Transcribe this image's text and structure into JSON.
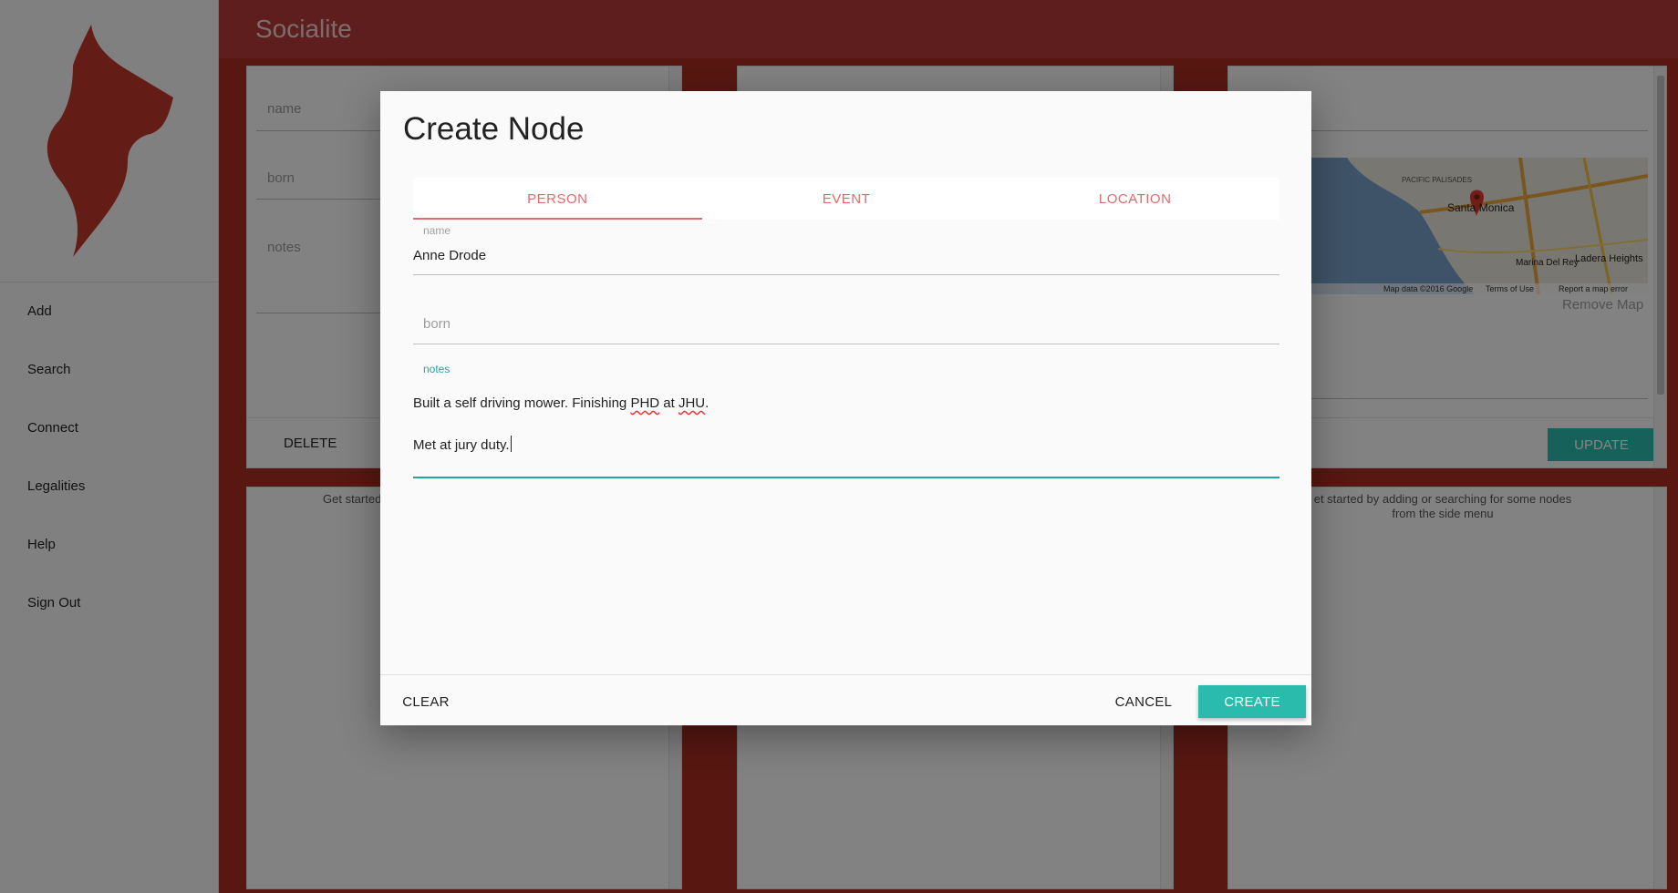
{
  "app": {
    "title": "Socialite"
  },
  "sidebar": {
    "items": [
      {
        "label": "Add"
      },
      {
        "label": "Search"
      },
      {
        "label": "Connect"
      },
      {
        "label": "Legalities"
      },
      {
        "label": "Help"
      },
      {
        "label": "Sign Out"
      }
    ]
  },
  "background": {
    "panel1": {
      "name_placeholder": "name",
      "born_placeholder": "born",
      "notes_placeholder": "notes",
      "delete_label": "DELETE",
      "hint": "Get started"
    },
    "panel3": {
      "map_attribution": "Map data ©2016 Google",
      "terms": "Terms of Use",
      "report": "Report a map error",
      "remove_map": "Remove Map",
      "update_label": "UPDATE",
      "hint_line1": "et started by adding or searching for some nodes",
      "hint_line2": "from the side menu"
    },
    "map_places": [
      "PACIFIC PALISADES",
      "Santa Monica",
      "Marina Del Rey",
      "Ladera Heights"
    ]
  },
  "dialog": {
    "title": "Create Node",
    "tabs": [
      {
        "label": "PERSON",
        "active": true
      },
      {
        "label": "EVENT",
        "active": false
      },
      {
        "label": "LOCATION",
        "active": false
      }
    ],
    "fields": {
      "name": {
        "label": "name",
        "value": "Anne Drode"
      },
      "born": {
        "placeholder": "born",
        "value": ""
      },
      "notes": {
        "label": "notes",
        "line1_a": "Built a self driving mower. Finishing ",
        "line1_b": "PHD",
        "line1_c": " at ",
        "line1_d": "JHU",
        "line1_e": ".",
        "line2": "Met at jury duty."
      }
    },
    "buttons": {
      "clear": "CLEAR",
      "cancel": "CANCEL",
      "create": "CREATE"
    }
  },
  "colors": {
    "brand_red": "#a92d22",
    "accent_teal": "#2bbbad",
    "tab_pink": "#e26a6a",
    "notes_focus": "#26a69a"
  }
}
